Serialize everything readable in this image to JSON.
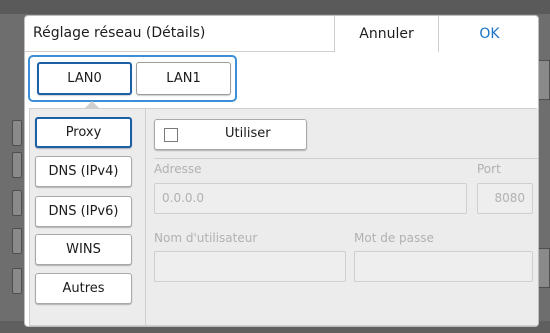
{
  "dialog": {
    "title": "Réglage réseau (Détails)",
    "cancel_label": "Annuler",
    "ok_label": "OK"
  },
  "interface_tabs": [
    "LAN0",
    "LAN1"
  ],
  "selected_tab": "LAN0",
  "categories": [
    "Proxy",
    "DNS (IPv4)",
    "DNS (IPv6)",
    "WINS",
    "Autres"
  ],
  "selected_category": "Proxy",
  "proxy": {
    "use_label": "Utiliser",
    "use_checked": false,
    "address_label": "Adresse",
    "address_value": "0.0.0.0",
    "port_label": "Port",
    "port_value": "8080",
    "username_label": "Nom d'utilisateur",
    "username_value": "",
    "password_label": "Mot de passe",
    "password_value": ""
  },
  "colors": {
    "accent": "#1a73c8",
    "focus_border": "#3a8fd6",
    "selected_border": "#1c5fa5",
    "disabled_text": "#b1b1b1"
  }
}
